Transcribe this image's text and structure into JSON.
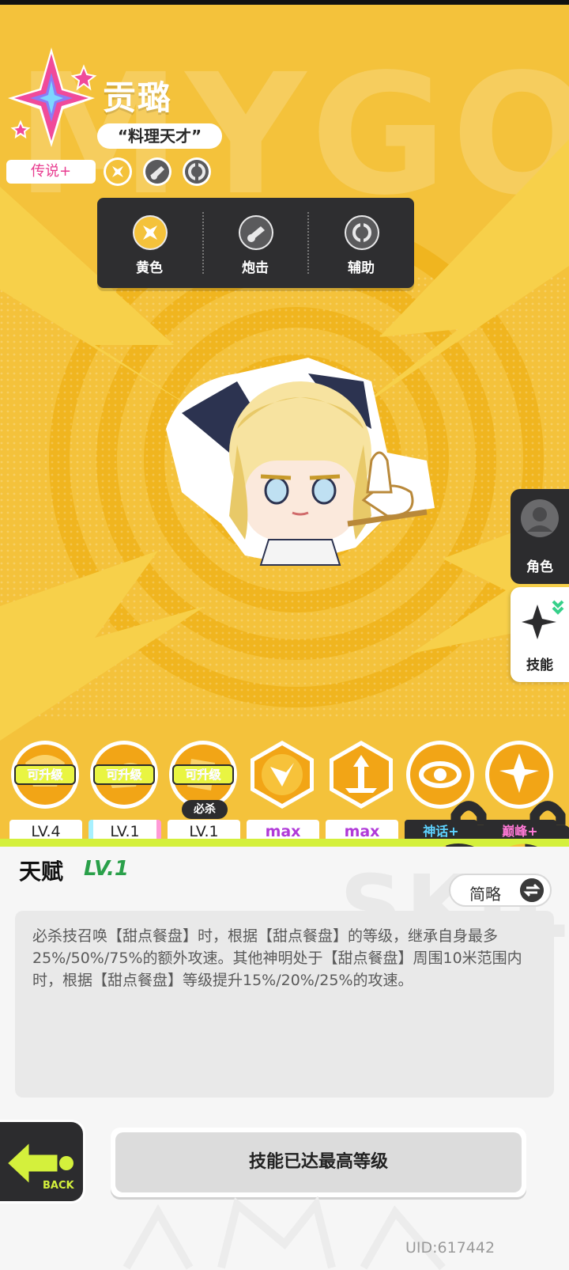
{
  "character": {
    "name": "贡璐",
    "title": "“料理天才”",
    "rarity": "传说+",
    "background_text": "MYGOD"
  },
  "classes": [
    {
      "label": "黄色",
      "icon": "yellow-element-icon"
    },
    {
      "label": "炮击",
      "icon": "cannon-icon"
    },
    {
      "label": "辅助",
      "icon": "support-icon"
    }
  ],
  "side_tabs": {
    "role": "角色",
    "skill": "技能"
  },
  "skills": {
    "upgrade_badge": "可升级",
    "ultimate_tag": "必杀",
    "levels": [
      "LV.4",
      "LV.1",
      "LV.1",
      "max",
      "max",
      "神话+",
      "巅峰+"
    ]
  },
  "talent": {
    "title": "天赋",
    "level": "LV.1",
    "toggle_label": "简略",
    "description": "必杀技召唤【甜点餐盘】时，根据【甜点餐盘】的等级，继承自身最多25%/50%/75%的额外攻速。其他神明处于【甜点餐盘】周围10米范围内时，根据【甜点餐盘】等级提升15%/20%/25%的攻速。",
    "background_text": "SKILL"
  },
  "footer": {
    "back_label": "BACK",
    "max_button": "技能已达最高等级",
    "uid": "UID:617442"
  },
  "colors": {
    "hero_bg": "#f4c23b",
    "panel_bg": "#f6f6f6",
    "accent_pink": "#e83b8f",
    "accent_green": "#2aa04a",
    "dark": "#2c2c2e"
  }
}
